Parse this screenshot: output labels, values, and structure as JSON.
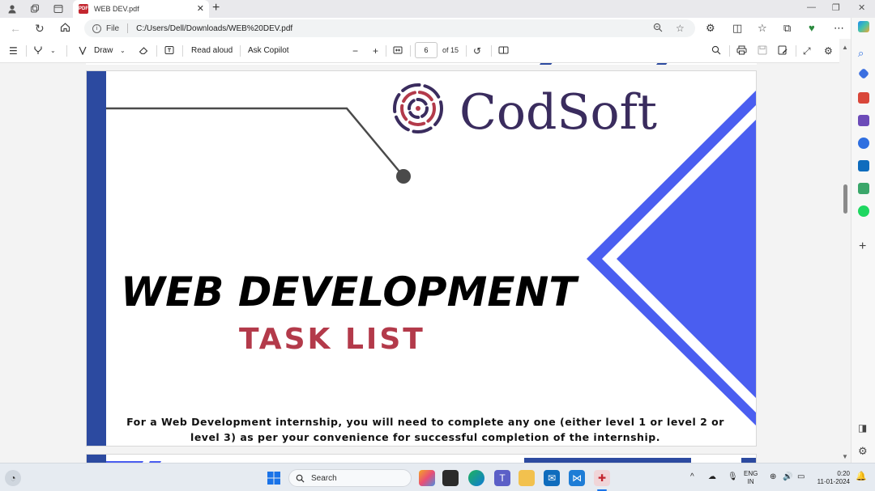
{
  "browser": {
    "tab_title": "WEB DEV.pdf",
    "tab_badge": "PDF",
    "address_prefix": "File",
    "url": "C:/Users/Dell/Downloads/WEB%20DEV.pdf"
  },
  "pdf_toolbar": {
    "draw_label": "Draw",
    "read_aloud_label": "Read aloud",
    "ask_copilot_label": "Ask Copilot",
    "current_page": "6",
    "page_total_label": "of 15"
  },
  "document": {
    "logo_text": "CodSoft",
    "headline": "WEB DEVELOPMENT",
    "subheadline": "TASK LIST",
    "note_line1": "For a Web Development internship, you will need to complete any one (either level 1 or level 2 or",
    "note_line2": "level 3) as per your convenience for successful completion of the internship."
  },
  "taskbar": {
    "search_label": "Search",
    "lang_line1": "ENG",
    "lang_line2": "IN",
    "time": "0:20",
    "date": "11-01-2024"
  },
  "colors": {
    "accent_blue": "#4a5ef0",
    "dark_blue": "#2c4aa0",
    "logo_purple": "#3a2c5e",
    "subhead_red": "#b33a4a"
  }
}
